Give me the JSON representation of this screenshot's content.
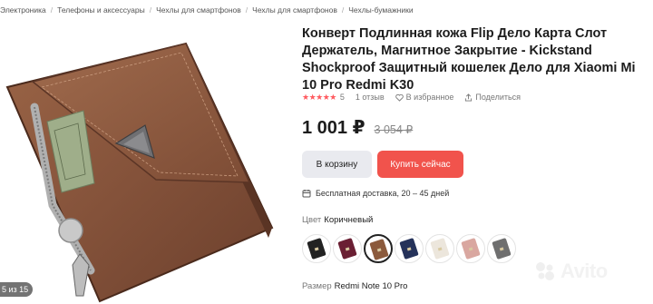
{
  "breadcrumb": [
    "Электроника",
    "Телефоны и аксессуары",
    "Чехлы для смартфонов",
    "Чехлы для смартфонов",
    "Чехлы-бумажники"
  ],
  "gallery": {
    "counter": "5 из 15"
  },
  "product": {
    "title": "Конверт Подлинная кожа Flip Дело Карта Слот Держатель, Магнитное Закрытие - Kickstand Shockproof Защитный кошелек Дело для Xiaomi Mi 10 Pro Redmi K30",
    "stars": "★★★★★",
    "rating": "5",
    "reviews": "1 отзыв",
    "favorite_label": "В избранное",
    "share_label": "Поделиться",
    "price": "1 001 ₽",
    "old_price": "3 054 ₽",
    "cart_label": "В корзину",
    "buy_label": "Купить сейчас",
    "delivery": "Бесплатная доставка, 20 – 45 дней",
    "color_label": "Цвет",
    "color_value": "Коричневый",
    "size_label": "Размер",
    "size_value": "Redmi Note 10 Pro"
  },
  "swatches": [
    {
      "name": "swatch-black",
      "color": "#222222",
      "selected": false
    },
    {
      "name": "swatch-burgundy",
      "color": "#6a1f33",
      "selected": false
    },
    {
      "name": "swatch-brown",
      "color": "#8b5a3c",
      "selected": true
    },
    {
      "name": "swatch-navy",
      "color": "#25325a",
      "selected": false
    },
    {
      "name": "swatch-white",
      "color": "#ece6dc",
      "selected": false
    },
    {
      "name": "swatch-pink",
      "color": "#d9a7a0",
      "selected": false
    },
    {
      "name": "swatch-gray",
      "color": "#6f6f6f",
      "selected": false
    }
  ],
  "watermark": "Avito",
  "colors": {
    "accent": "#f1534c",
    "star": "#ff5a5f",
    "secondary_button": "#e9eaef"
  }
}
